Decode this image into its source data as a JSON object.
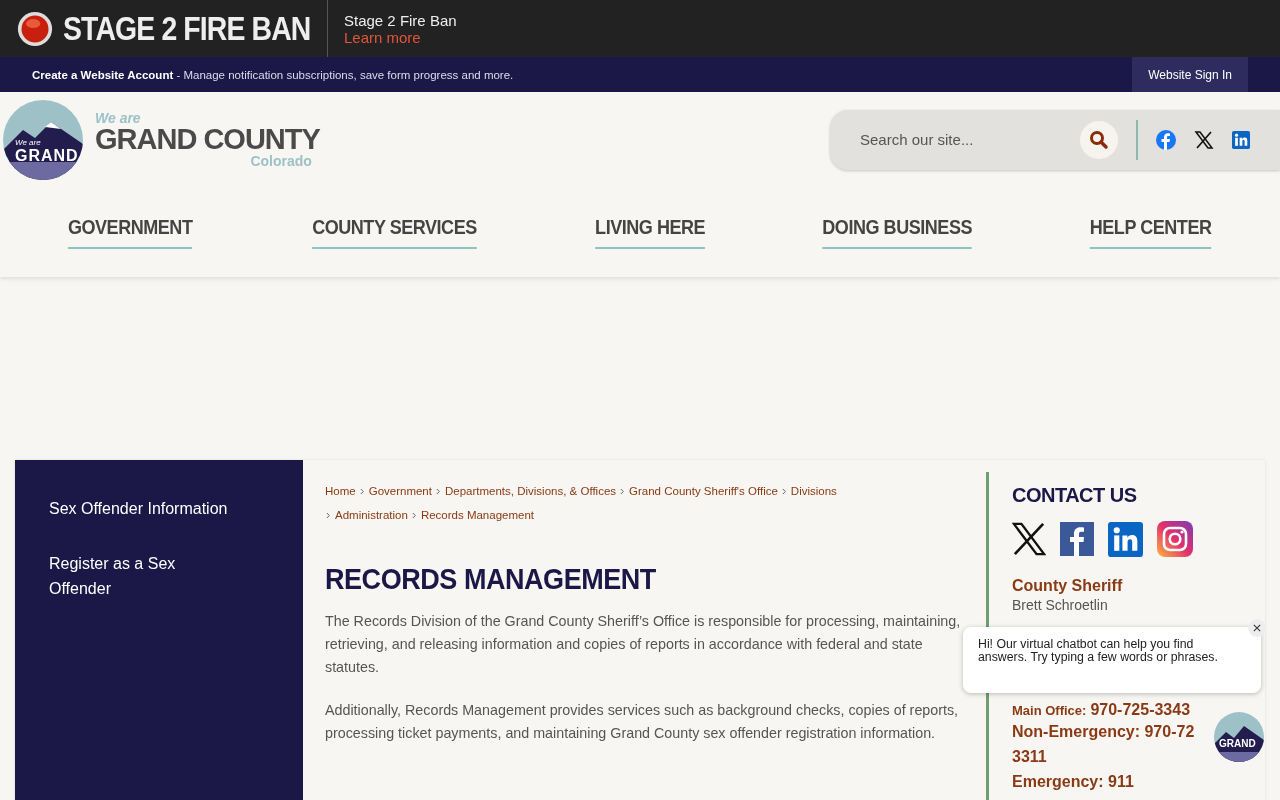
{
  "alert": {
    "title": "STAGE 2 FIRE BAN",
    "message": "Stage 2 Fire Ban",
    "link": "Learn more"
  },
  "account_bar": {
    "link": "Create a Website Account",
    "text": "- Manage notification subscriptions, save form progress and more.",
    "sign_in": "Website Sign In"
  },
  "logo": {
    "badge_small": "We are",
    "badge_word": "GRAND",
    "tagline": "We are",
    "name": "GRAND COUNTY",
    "region": "Colorado"
  },
  "search": {
    "placeholder": "Search our site..."
  },
  "nav": [
    {
      "label": "GOVERNMENT"
    },
    {
      "label": "COUNTY SERVICES"
    },
    {
      "label": "LIVING HERE"
    },
    {
      "label": "DOING BUSINESS"
    },
    {
      "label": "HELP CENTER"
    }
  ],
  "sidebar": {
    "items": [
      "Sex Offender Information",
      "Register as a Sex Offender"
    ]
  },
  "breadcrumb": [
    "Home",
    "Government",
    "Departments, Divisions, & Offices",
    "Grand County Sheriff's Office",
    "Divisions",
    "Administration",
    "Records Management"
  ],
  "page_title": "RECORDS MANAGEMENT",
  "paragraphs": [
    "The Records Division of the Grand County Sheriff’s Office is responsible for processing, maintaining, retrieving, and releasing information and copies of reports in accordance with federal and state statutes.",
    "Additionally, Records Management provides services such as background checks, copies of reports, processing ticket payments, and maintaining Grand County sex offender registration information."
  ],
  "contact": {
    "heading": "CONTACT US",
    "title": "County Sheriff",
    "name": "Brett Schroetlin",
    "main_office_label": "Main Office:",
    "main_office_number": "970-725-3343",
    "non_emergency": "Non-Emergency: 970-72",
    "non_emergency_cont": "3311",
    "emergency": "Emergency: 911"
  },
  "chatbot": {
    "message": "Hi! Our virtual chatbot can help you find answers. Try typing a few words or phrases.",
    "avatar_text": "GRAND"
  }
}
